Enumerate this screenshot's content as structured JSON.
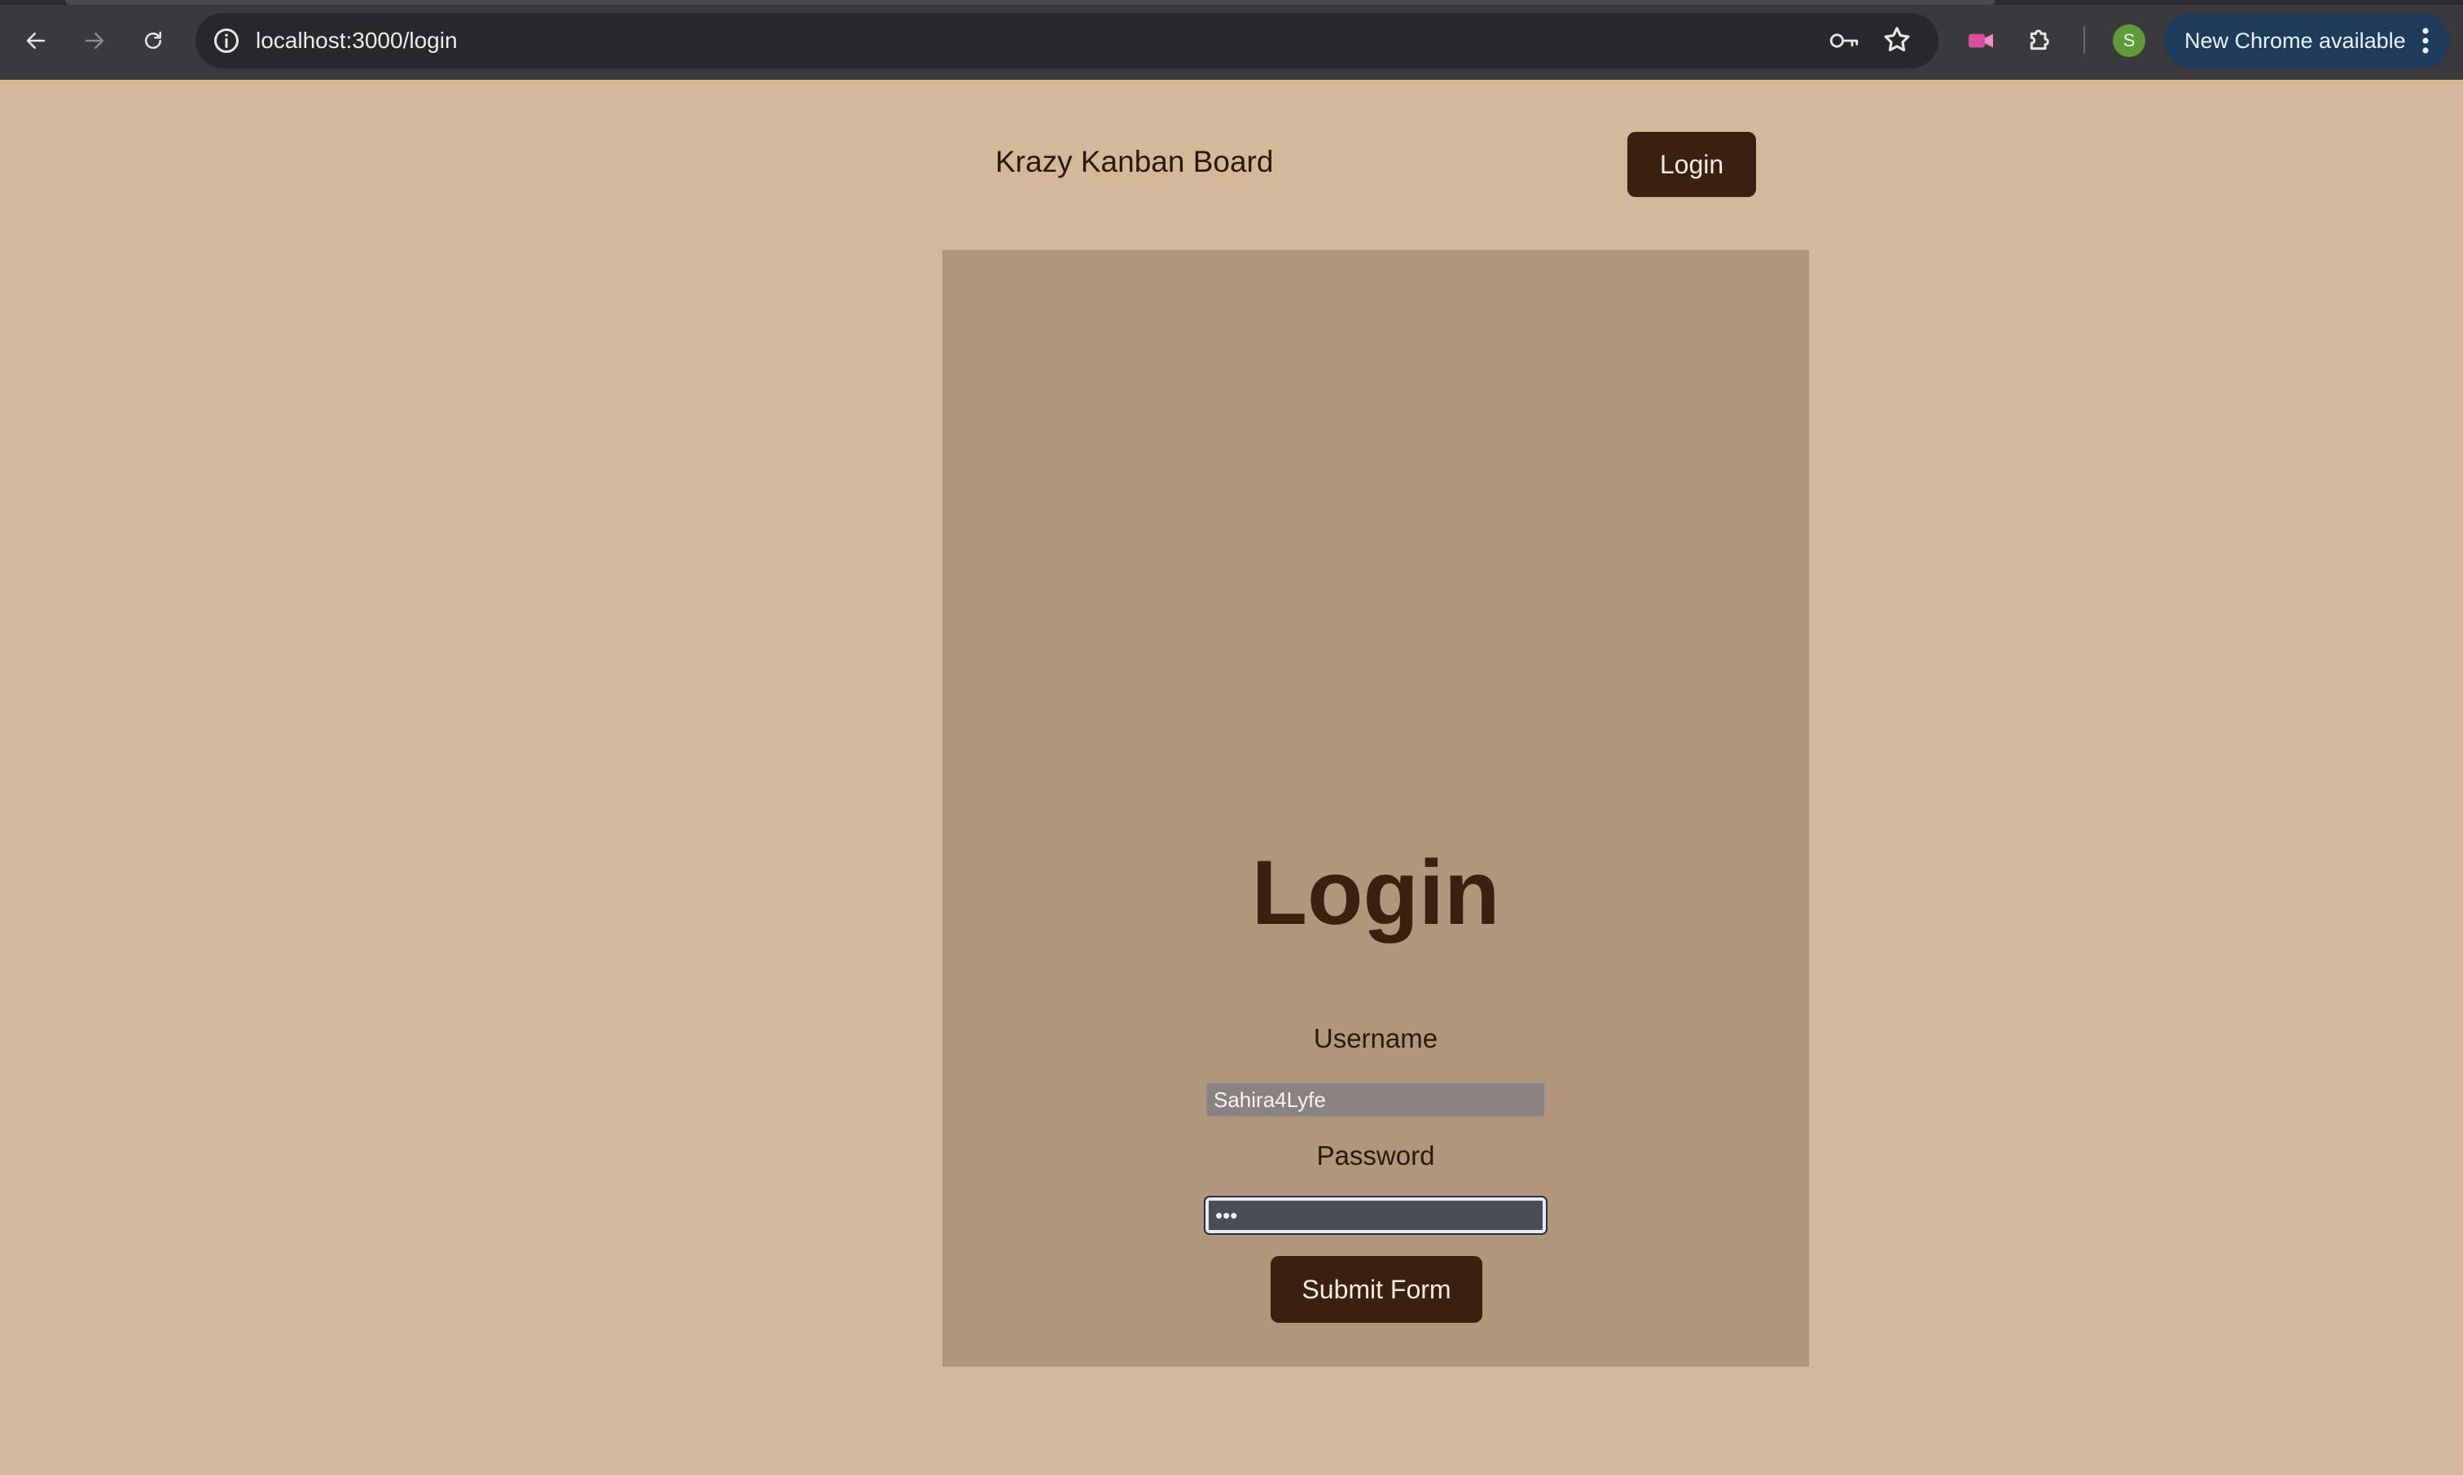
{
  "browser": {
    "url": "localhost:3000/login",
    "profile_initial": "S",
    "update_label": "New Chrome available",
    "icons": {
      "back": "arrow-left-icon",
      "forward": "arrow-right-icon",
      "reload": "reload-icon",
      "site_info": "info-icon",
      "password_key": "key-icon",
      "bookmark": "star-icon",
      "media_extension": "media-icon",
      "extensions": "puzzle-icon",
      "menu": "more-vert-icon"
    }
  },
  "header": {
    "brand": "Krazy Kanban Board",
    "login_label": "Login"
  },
  "form": {
    "title": "Login",
    "username_label": "Username",
    "username_value": "Sahira4Lyfe",
    "password_label": "Password",
    "password_value": "•••",
    "submit_label": "Submit Form"
  },
  "colors": {
    "page_bg": "#d4b899",
    "card_bg": "#b1967b",
    "button_bg": "#3b2010",
    "text_dark": "#2a1a0e",
    "update_pill": "#1f3b5c",
    "avatar": "#5f9b3a"
  }
}
